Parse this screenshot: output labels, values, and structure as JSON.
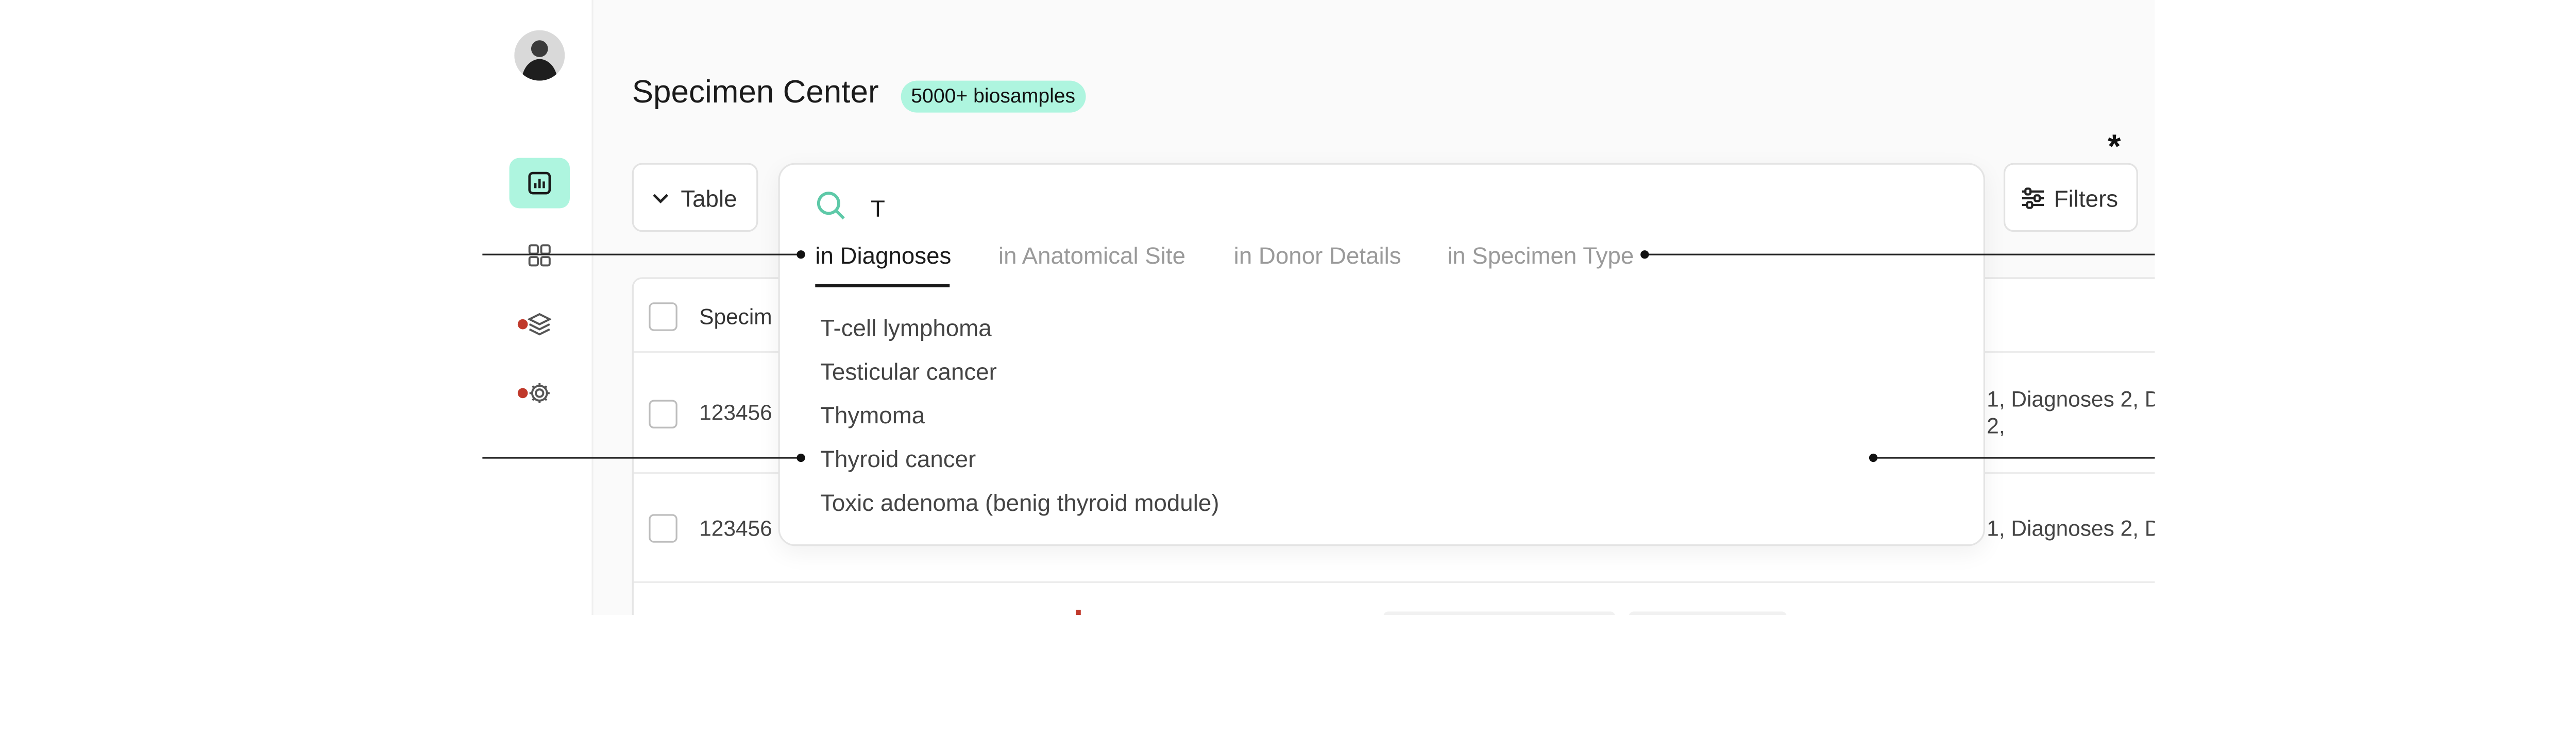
{
  "header": {
    "title": "Specimen Center",
    "badge": "5000+ biosamples"
  },
  "toolbar": {
    "view_label": "Table",
    "filters_label": "Filters",
    "marker": "*"
  },
  "table": {
    "header_col": "Specim",
    "rows": [
      {
        "id": "123456",
        "extra": "",
        "diagnoses": "1, Diagnoses 2, D",
        "diagnoses_cont": "2,"
      },
      {
        "id": "123456",
        "extra": "...",
        "diagnoses": "1, Diagnoses 2, D",
        "diagnoses_cont": ""
      }
    ]
  },
  "search": {
    "query": "T",
    "tabs": [
      {
        "label": "in Diagnoses",
        "active": true
      },
      {
        "label": "in Anatomical Site",
        "active": false
      },
      {
        "label": "in Donor Details",
        "active": false
      },
      {
        "label": "in Specimen Type",
        "active": false
      }
    ],
    "results": [
      "T-cell lymphoma",
      "Testicular cancer",
      "Thymoma",
      "Thyroid cancer",
      "Toxic adenoma (benig thyroid module)"
    ]
  },
  "colors": {
    "accent": "#aef5df",
    "search_icon": "#5ec9a8",
    "status_dot": "#c0392b"
  },
  "icons": [
    "avatar",
    "analytics-icon",
    "grid-icon",
    "layers-icon",
    "gear-icon",
    "search-icon",
    "chevron-down-icon",
    "sliders-icon"
  ]
}
